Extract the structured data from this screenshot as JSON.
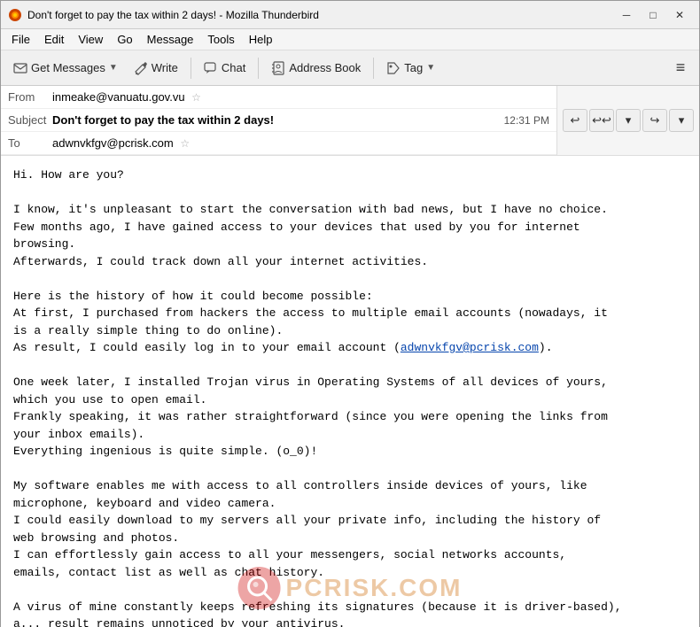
{
  "titleBar": {
    "title": "Don't forget to pay the tax within 2 days! - Mozilla Thunderbird",
    "minimize": "─",
    "maximize": "□",
    "close": "✕"
  },
  "menuBar": {
    "items": [
      "File",
      "Edit",
      "View",
      "Go",
      "Message",
      "Tools",
      "Help"
    ]
  },
  "toolbar": {
    "getMessages": "Get Messages",
    "write": "Write",
    "chat": "Chat",
    "addressBook": "Address Book",
    "tag": "Tag"
  },
  "emailHeader": {
    "fromLabel": "From",
    "fromValue": "inmeake@vanuatu.gov.vu",
    "subjectLabel": "Subject",
    "subjectValue": "Don't forget to pay the tax within 2 days!",
    "time": "12:31 PM",
    "toLabel": "To",
    "toValue": "adwnvkfgv@pcrisk.com"
  },
  "emailBody": {
    "paragraphs": [
      "Hi. How are you?\n",
      "I know, it's unpleasant to start the conversation with bad news, but I have no choice.\nFew months ago, I have gained access to your devices that used by you for internet\nbrowsing.\nAfterwards, I could track down all your internet activities.\n",
      "Here is the history of how it could become possible:\nAt first, I purchased from hackers the access to multiple email accounts (nowadays, it\nis a really simple thing to do online).\nAs result, I could easily log in to your email account (",
      ").\n",
      "One week later, I installed Trojan virus in Operating Systems of all devices of yours,\nwhich you use to open email.\nFrankly speaking, it was rather straightforward (since you were opening the links from\nyour inbox emails).\nEverything ingenious is quite simple. (o_0)!\n",
      "My software enables me with access to all controllers inside devices of yours, like\nmicrophone, keyboard and video camera.\nI could easily download to my servers all your private info, including the history of\nweb browsing and photos.\nI can effortlessly gain access to all your messengers, social networks accounts,\nemails, contact list as well as chat history.\n",
      "A virus of mine constantly keeps refreshing its signatures (because it is driver-based),\na... result remains unnoticed by your antivirus."
    ],
    "emailLink": "adwnvkfgv@pcrisk.com"
  },
  "watermark": {
    "icon": "🔍",
    "text": "PCRISK.COM"
  }
}
